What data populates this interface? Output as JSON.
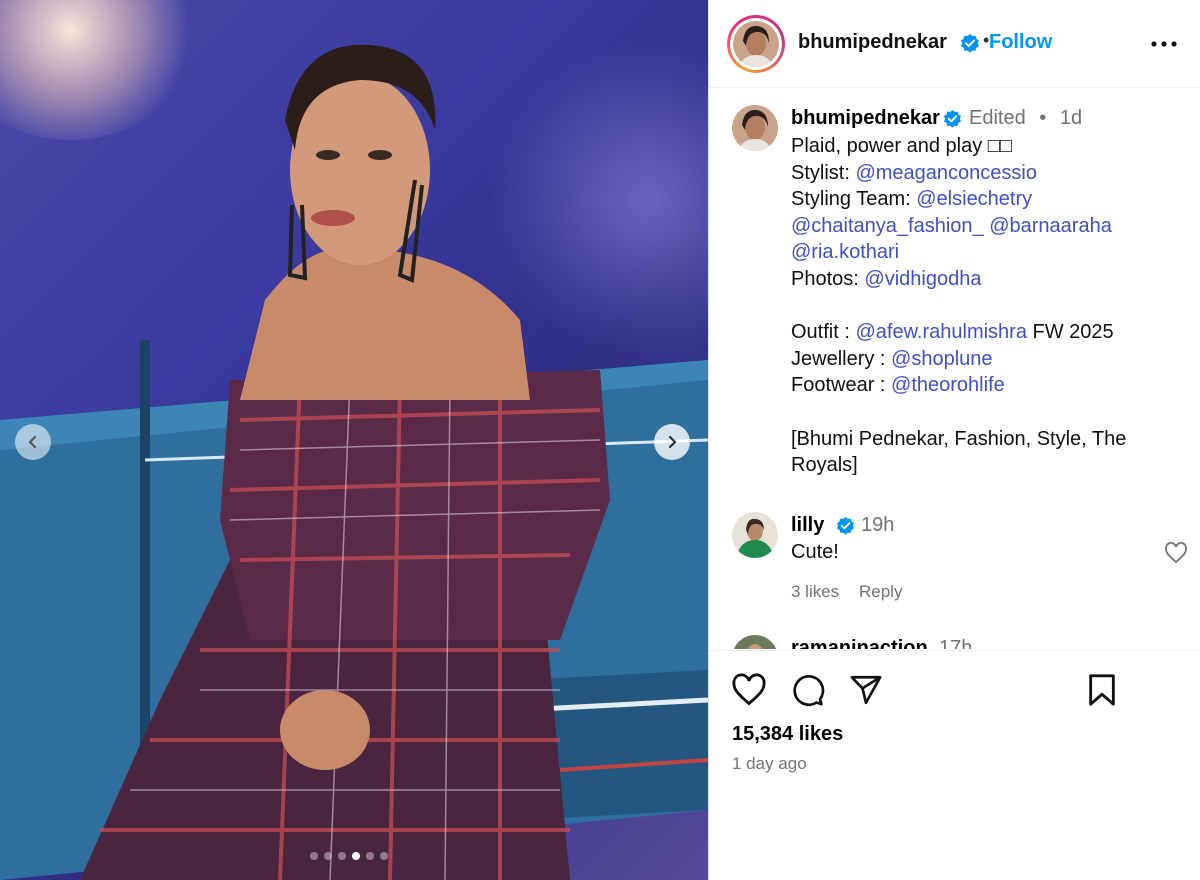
{
  "post": {
    "username": "bhumipednekar",
    "follow_label": "Follow",
    "separator": "•"
  },
  "caption": {
    "username": "bhumipednekar",
    "edited": "Edited",
    "dot": "•",
    "time": "1d",
    "line1": "Plaid, power and play □□",
    "stylist_label": "Stylist:",
    "stylist": "@meaganconcessio",
    "team_label": "Styling Team:",
    "team1": "@elsiechetry",
    "team2": "@chaitanya_fashion_",
    "team3": "@barnaaraha",
    "team4": "@ria.kothari",
    "photos_label": "Photos:",
    "photos": "@vidhigodha",
    "outfit_label": "Outfit :",
    "outfit": "@afew.rahulmishra",
    "outfit_suffix": "FW 2025",
    "jewellery_label": "Jewellery :",
    "jewellery": "@shoplune",
    "footwear_label": "Footwear :",
    "footwear": "@theorohlife",
    "tags": "[Bhumi Pednekar, Fashion, Style, The Royals]"
  },
  "comments": [
    {
      "username": "lilly",
      "time": "19h",
      "text": "Cute!",
      "likes": "3 likes",
      "reply": "Reply"
    },
    {
      "username": "ramaninaction",
      "time": "17h"
    }
  ],
  "footer": {
    "likes": "15,384 likes",
    "time_ago": "1 day ago"
  },
  "carousel": {
    "total": 6,
    "active_index": 3
  },
  "colors": {
    "link": "#3f4fcc",
    "follow": "#0095f6",
    "verified": "#0095f6"
  },
  "icons": [
    "verified-icon",
    "more-icon",
    "chevron-left-icon",
    "chevron-right-icon",
    "heart-icon",
    "comment-icon",
    "share-icon",
    "bookmark-icon"
  ]
}
